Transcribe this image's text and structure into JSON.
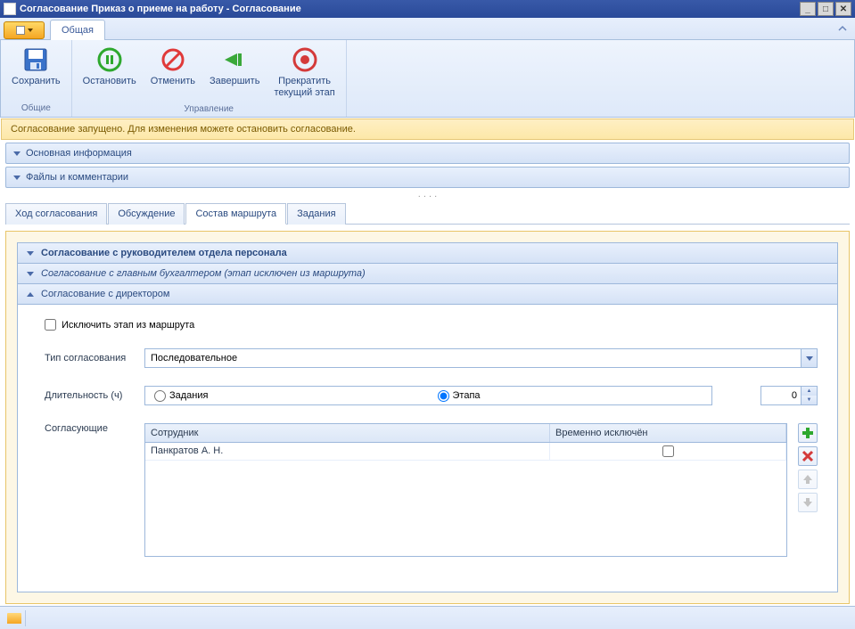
{
  "window": {
    "title": "Согласование Приказ о приеме на работу - Согласование"
  },
  "ribbon": {
    "tab": "Общая",
    "groups": {
      "common": {
        "label": "Общие",
        "save": "Сохранить"
      },
      "manage": {
        "label": "Управление",
        "stop": "Остановить",
        "cancel": "Отменить",
        "finish": "Завершить",
        "stopCurrent": "Прекратить\nтекущий этап"
      }
    }
  },
  "infobar": "Согласование запущено. Для изменения можете остановить согласование.",
  "accordion": {
    "info": "Основная информация",
    "files": "Файлы и комментарии"
  },
  "tabs": {
    "flow": "Ход согласования",
    "discussion": "Обсуждение",
    "route": "Состав маршрута",
    "tasks": "Задания"
  },
  "stages": {
    "s1": "Согласование с руководителем отдела персонала",
    "s2": "Согласование с главным бухгалтером (этап исключен из маршрута)",
    "s3": "Согласование с директором"
  },
  "form": {
    "excludeStage": "Исключить этап из маршрута",
    "approvalType": {
      "label": "Тип согласования",
      "value": "Последовательное"
    },
    "duration": {
      "label": "Длительность (ч)",
      "value": "0",
      "optTask": "Задания",
      "optStage": "Этапа"
    },
    "approvers": {
      "label": "Согласующие",
      "colEmployee": "Сотрудник",
      "colExcluded": "Временно исключён",
      "rows": [
        {
          "employee": "Панкратов А. Н.",
          "excluded": false
        }
      ]
    }
  }
}
